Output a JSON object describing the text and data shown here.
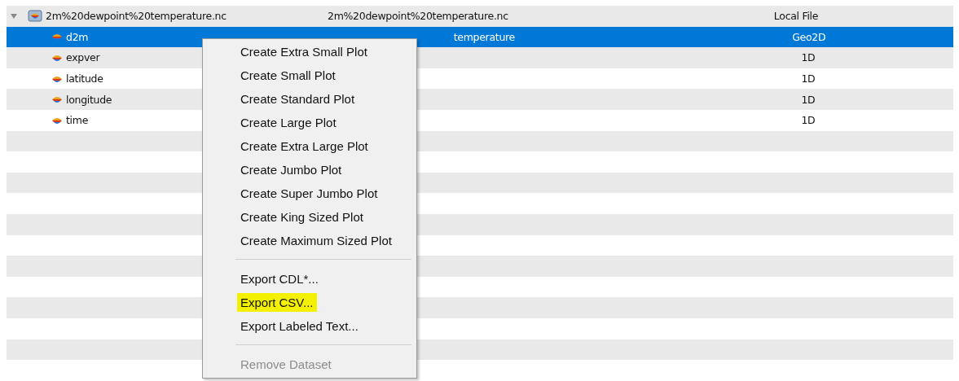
{
  "tree": {
    "file": {
      "name": "2m%20dewpoint%20temperature.nc",
      "description": "2m%20dewpoint%20temperature.nc",
      "type": "Local File",
      "expanded": true,
      "selected": false
    },
    "variables": [
      {
        "name": "d2m",
        "description": "temperature",
        "type": "Geo2D",
        "selected": true
      },
      {
        "name": "expver",
        "type": "1D",
        "selected": false
      },
      {
        "name": "latitude",
        "type": "1D",
        "selected": false
      },
      {
        "name": "longitude",
        "type": "1D",
        "selected": false
      },
      {
        "name": "time",
        "type": "1D",
        "selected": false
      }
    ]
  },
  "context_menu": {
    "items": [
      {
        "kind": "item",
        "label": "Create Extra Small Plot",
        "highlighted": false,
        "disabled": false
      },
      {
        "kind": "item",
        "label": "Create Small Plot",
        "highlighted": false,
        "disabled": false
      },
      {
        "kind": "item",
        "label": "Create Standard Plot",
        "highlighted": false,
        "disabled": false
      },
      {
        "kind": "item",
        "label": "Create Large Plot",
        "highlighted": false,
        "disabled": false
      },
      {
        "kind": "item",
        "label": "Create Extra Large Plot",
        "highlighted": false,
        "disabled": false
      },
      {
        "kind": "item",
        "label": "Create Jumbo Plot",
        "highlighted": false,
        "disabled": false
      },
      {
        "kind": "item",
        "label": "Create Super Jumbo Plot",
        "highlighted": false,
        "disabled": false
      },
      {
        "kind": "item",
        "label": "Create King Sized Plot",
        "highlighted": false,
        "disabled": false
      },
      {
        "kind": "item",
        "label": "Create Maximum Sized Plot",
        "highlighted": false,
        "disabled": false
      },
      {
        "kind": "separator"
      },
      {
        "kind": "item",
        "label": "Export CDL*...",
        "highlighted": false,
        "disabled": false
      },
      {
        "kind": "item",
        "label": "Export CSV...",
        "highlighted": true,
        "disabled": false
      },
      {
        "kind": "item",
        "label": "Export Labeled Text...",
        "highlighted": false,
        "disabled": false
      },
      {
        "kind": "separator"
      },
      {
        "kind": "item",
        "label": "Remove Dataset",
        "highlighted": false,
        "disabled": true
      }
    ]
  }
}
